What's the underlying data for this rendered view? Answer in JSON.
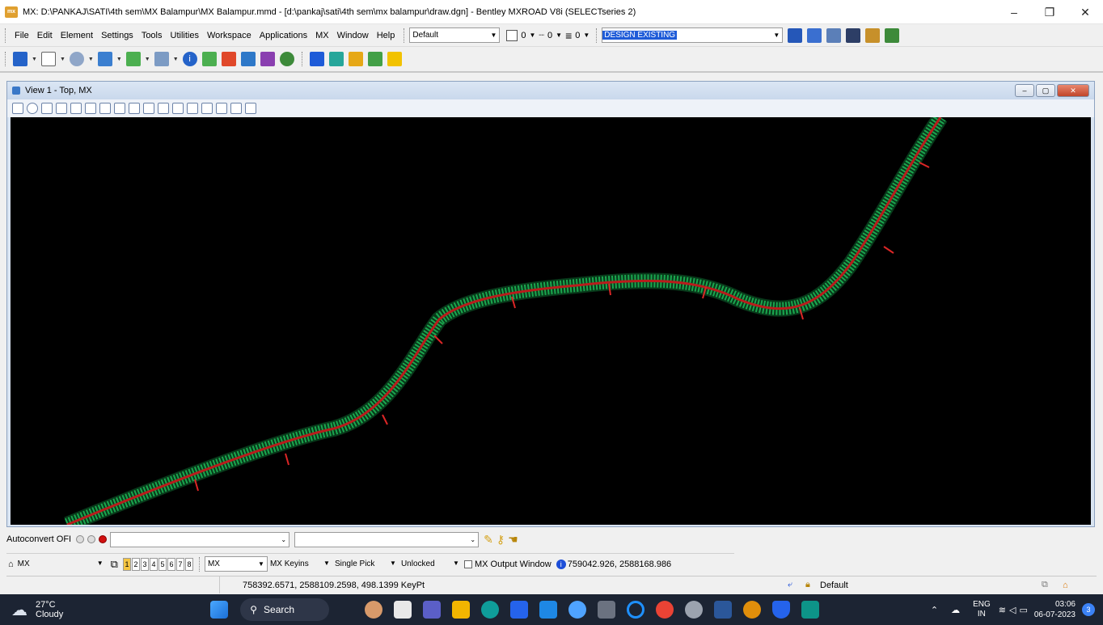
{
  "window": {
    "app_badge": "mx",
    "title": "MX: D:\\PANKAJ\\SATI\\4th sem\\MX Balampur\\MX Balampur.mmd - [d:\\pankaj\\sati\\4th sem\\mx balampur\\draw.dgn] - Bentley MXROAD V8i (SELECTseries 2)",
    "minimize": "–",
    "restore": "❐",
    "close": "✕"
  },
  "menus": [
    "File",
    "Edit",
    "Element",
    "Settings",
    "Tools",
    "Utilities",
    "Workspace",
    "Applications",
    "MX",
    "Window",
    "Help"
  ],
  "attributes": {
    "level": "Default",
    "color": "0",
    "style": "0",
    "weight": "0",
    "active_level_name": "DESIGN EXISTING"
  },
  "view": {
    "title": "View 1 - Top, MX"
  },
  "status": {
    "autoconvert": "Autoconvert OFI",
    "model_name": "MX",
    "view_tabs": [
      "1",
      "2",
      "3",
      "4",
      "5",
      "6",
      "7",
      "8"
    ],
    "active_view_tab": "1",
    "mx_combo": "MX",
    "mx_keyins": "MX Keyins",
    "single_pick": "Single Pick",
    "unlocked": "Unlocked",
    "output_window": "MX Output Window",
    "coords_top": "759042.926, 2588168.986",
    "keypoint": "758392.6571, 2588109.2598, 498.1399 KeyPt",
    "default_label": "Default"
  },
  "taskbar": {
    "weather_temp": "27°C",
    "weather_desc": "Cloudy",
    "search": "Search",
    "lang": "ENG",
    "region": "IN",
    "time": "03:06",
    "date": "06-07-2023",
    "notif_count": "3"
  },
  "colors": {
    "road_edge": "#22c55e",
    "road_center": "#b91c1c",
    "canvas_bg": "#000000",
    "active_level_bg": "#1e5bd8"
  }
}
